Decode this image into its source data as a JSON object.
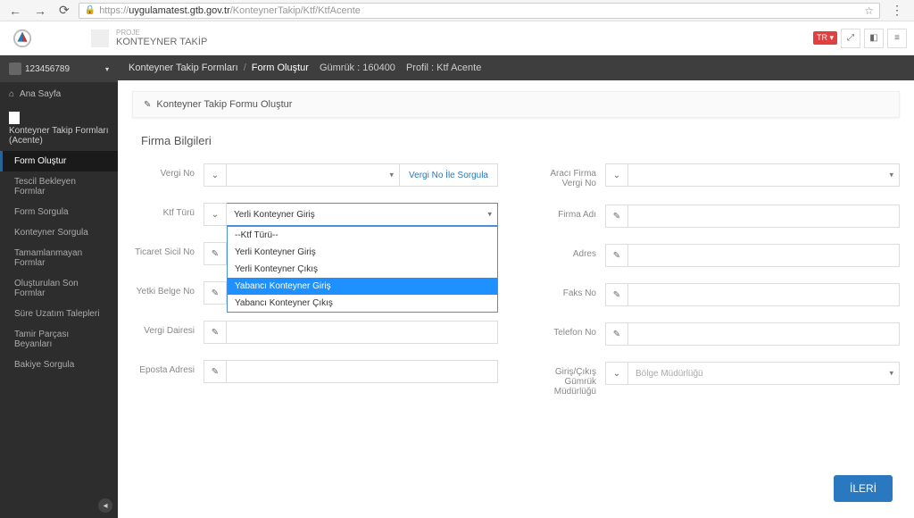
{
  "browser": {
    "url_secure": "https://",
    "url_host": "uygulamatest.gtb.gov.tr",
    "url_path": "/KonteynerTakip/Ktf/KtfAcente"
  },
  "header": {
    "project_label": "PROJE",
    "project_name": "KONTEYNER TAKİP",
    "lang": "TR"
  },
  "sidebar": {
    "user": "123456789",
    "home": "Ana Sayfa",
    "section": "Konteyner Takip Formları (Acente)",
    "items": [
      "Form Oluştur",
      "Tescil Bekleyen Formlar",
      "Form Sorgula",
      "Konteyner Sorgula",
      "Tamamlanmayan Formlar",
      "Oluşturulan Son Formlar",
      "Süre Uzatım Talepleri",
      "Tamir Parçası Beyanları",
      "Bakiye Sorgula"
    ]
  },
  "breadcrumb": {
    "a": "Konteyner Takip Formları",
    "b": "Form Oluştur",
    "gumruk": "Gümrük : 160400",
    "profil": "Profil : Ktf Acente"
  },
  "panel": {
    "title": "Konteyner Takip Formu Oluştur",
    "section": "Firma Bilgileri"
  },
  "labels": {
    "vergi_no": "Vergi No",
    "vergi_sorgula": "Vergi No İle Sorgula",
    "ktf_turu": "Ktf Türü",
    "ticaret_sicil": "Ticaret Sicil No",
    "yetki_belge": "Yetki Belge No",
    "vergi_dairesi": "Vergi Dairesi",
    "eposta": "Eposta Adresi",
    "araci_firma": "Aracı Firma Vergi No",
    "firma_adi": "Firma Adı",
    "adres": "Adres",
    "faks": "Faks No",
    "telefon": "Telefon No",
    "giris_cikis": "Giriş/Çıkış Gümrük Müdürlüğü",
    "bolge_placeholder": "Bölge Müdürlüğü"
  },
  "ktf": {
    "selected": "Yerli Konteyner Giriş",
    "options": [
      "--Ktf Türü--",
      "Yerli Konteyner Giriş",
      "Yerli Konteyner Çıkış",
      "Yabancı Konteyner Giriş",
      "Yabancı Konteyner Çıkış"
    ]
  },
  "buttons": {
    "ileri": "İLERİ"
  }
}
